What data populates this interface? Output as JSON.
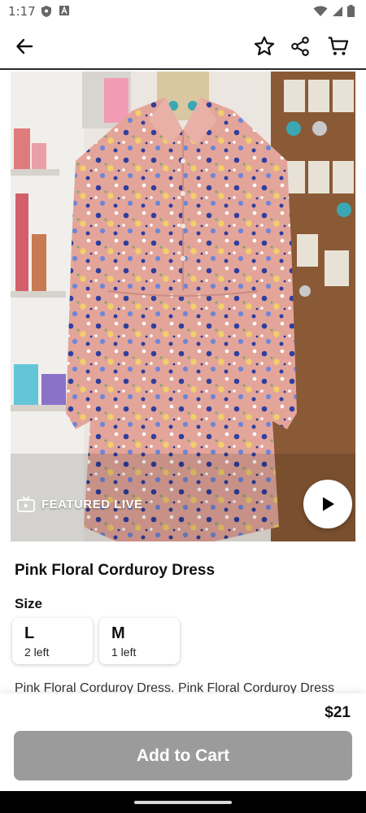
{
  "status_bar": {
    "time": "1:17",
    "icons": [
      "shield-icon",
      "a-box-icon",
      "wifi-icon",
      "signal-icon",
      "battery-icon"
    ]
  },
  "app_bar": {
    "icons": [
      "back-arrow-icon",
      "star-icon",
      "share-icon",
      "cart-icon"
    ]
  },
  "media": {
    "featured_label": "FEATURED LIVE",
    "play_icon": "play-icon"
  },
  "product": {
    "title": "Pink Floral Corduroy Dress",
    "size_heading": "Size",
    "sizes": [
      {
        "name": "L",
        "stock": "2 left"
      },
      {
        "name": "M",
        "stock": "1 left"
      }
    ],
    "description": "Pink Floral Corduroy Dress. Pink Floral Corduroy Dress",
    "price": "$21"
  },
  "actions": {
    "add_to_cart": "Add to Cart"
  },
  "colors": {
    "accent_disabled_button": "#9b9b9b",
    "dress_pink": "#e3a59a",
    "floral_blue": "#2f3f9e"
  }
}
